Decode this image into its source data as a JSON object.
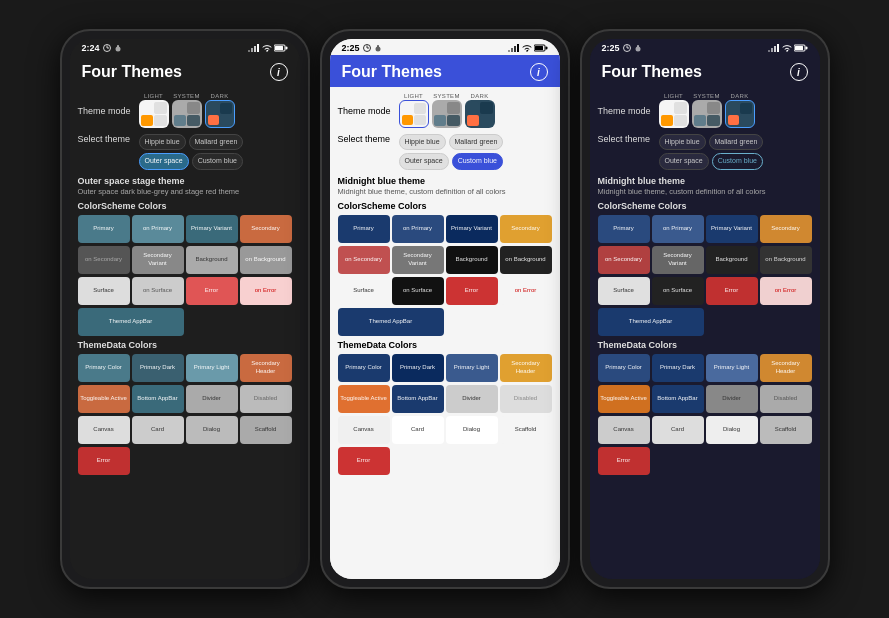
{
  "phones": [
    {
      "id": "phone-dark",
      "variant": "dark",
      "status": {
        "time": "2:24",
        "icons_left": [
          "clock",
          "notification"
        ],
        "icons_right": [
          "signal",
          "wifi",
          "battery"
        ]
      },
      "app_title": "Four Themes",
      "theme_mode": {
        "label": "Theme mode",
        "options": [
          "LIGHT",
          "SYSTEM",
          "DARK"
        ],
        "selected": "DARK"
      },
      "select_theme": {
        "label": "Select theme",
        "options": [
          {
            "name": "Hippie blue",
            "selected": false
          },
          {
            "name": "Mallard green",
            "selected": false
          },
          {
            "name": "Outer space",
            "selected": true
          },
          {
            "name": "Custom blue",
            "selected": false
          }
        ]
      },
      "theme_name": "Outer space stage theme",
      "theme_desc": "Outer space dark blue-grey and stage red theme",
      "colorscheme_title": "ColorScheme Colors",
      "color_rows": [
        [
          {
            "label": "Primary",
            "bg": "#4a7a8a",
            "color": "#fff"
          },
          {
            "label": "on Primary",
            "bg": "#5a8a9a",
            "color": "#fff"
          },
          {
            "label": "Primary Variant",
            "bg": "#3a6a7a",
            "color": "#fff"
          },
          {
            "label": "Secondary",
            "bg": "#c96a40",
            "color": "#fff"
          }
        ],
        [
          {
            "label": "on Secondary",
            "bg": "#555",
            "color": "#aaa"
          },
          {
            "label": "Secondary Variant",
            "bg": "#888",
            "color": "#fff"
          },
          {
            "label": "Background",
            "bg": "#aaa",
            "color": "#333"
          },
          {
            "label": "on Background",
            "bg": "#999",
            "color": "#fff"
          }
        ],
        [
          {
            "label": "Surface",
            "bg": "#ddd",
            "color": "#333"
          },
          {
            "label": "on Surface",
            "bg": "#ccc",
            "color": "#555"
          },
          {
            "label": "Error",
            "bg": "#e05555",
            "color": "#fff"
          },
          {
            "label": "on Error",
            "bg": "#f8d0d0",
            "color": "#c00"
          }
        ],
        [
          {
            "label": "Themed AppBar",
            "bg": "#3a6a7a",
            "color": "#fff",
            "span": 2
          }
        ]
      ],
      "themedata_title": "ThemeData Colors",
      "themedata_rows": [
        [
          {
            "label": "Primary Color",
            "bg": "#4a7a8a",
            "color": "#fff"
          },
          {
            "label": "Primary Dark",
            "bg": "#3a6070",
            "color": "#fff"
          },
          {
            "label": "Primary Light",
            "bg": "#6a9aaa",
            "color": "#fff"
          },
          {
            "label": "Secondary Header",
            "bg": "#c96a40",
            "color": "#fff"
          }
        ],
        [
          {
            "label": "Toggleable Active",
            "bg": "#c96a40",
            "color": "#fff"
          },
          {
            "label": "Bottom AppBar",
            "bg": "#3a6a7a",
            "color": "#fff"
          },
          {
            "label": "Divider",
            "bg": "#aaa",
            "color": "#333"
          },
          {
            "label": "Disabled",
            "bg": "#bbb",
            "color": "#666"
          }
        ],
        [
          {
            "label": "Canvas",
            "bg": "#ddd",
            "color": "#333"
          },
          {
            "label": "Card",
            "bg": "#ccc",
            "color": "#333"
          },
          {
            "label": "Dialog",
            "bg": "#bbb",
            "color": "#333"
          },
          {
            "label": "Scaffold",
            "bg": "#aaa",
            "color": "#333"
          }
        ]
      ]
    },
    {
      "id": "phone-light",
      "variant": "light",
      "status": {
        "time": "2:25",
        "icons_left": [
          "clock",
          "notification"
        ],
        "icons_right": [
          "signal",
          "wifi",
          "battery"
        ]
      },
      "app_title": "Four Themes",
      "theme_mode": {
        "label": "Theme mode",
        "options": [
          "LIGHT",
          "SYSTEM",
          "DARK"
        ],
        "selected": "LIGHT"
      },
      "select_theme": {
        "label": "Select theme",
        "options": [
          {
            "name": "Hippie blue",
            "selected": false
          },
          {
            "name": "Mallard green",
            "selected": false
          },
          {
            "name": "Outer space",
            "selected": false
          },
          {
            "name": "Custom blue",
            "selected": true
          }
        ]
      },
      "theme_name": "Midnight blue theme",
      "theme_desc": "Midnight blue theme, custom definition of all colors",
      "colorscheme_title": "ColorScheme Colors",
      "color_rows": [
        [
          {
            "label": "Primary",
            "bg": "#1a3a6e",
            "color": "#fff"
          },
          {
            "label": "on Primary",
            "bg": "#2a4a7e",
            "color": "#fff"
          },
          {
            "label": "Primary Variant",
            "bg": "#0a2a5e",
            "color": "#fff"
          },
          {
            "label": "Secondary",
            "bg": "#e0a030",
            "color": "#fff"
          }
        ],
        [
          {
            "label": "on Secondary",
            "bg": "#c05050",
            "color": "#fff"
          },
          {
            "label": "Secondary Variant",
            "bg": "#777",
            "color": "#fff"
          },
          {
            "label": "Background",
            "bg": "#111",
            "color": "#eee"
          },
          {
            "label": "on Background",
            "bg": "#222",
            "color": "#eee"
          }
        ],
        [
          {
            "label": "Surface",
            "bg": "#f5f5f5",
            "color": "#333"
          },
          {
            "label": "on Surface",
            "bg": "#111",
            "color": "#eee"
          },
          {
            "label": "Error",
            "bg": "#cc3333",
            "color": "#fff"
          },
          {
            "label": "on Error",
            "bg": "#f5f5f5",
            "color": "#c00"
          }
        ],
        [
          {
            "label": "Themed AppBar",
            "bg": "#1a3a6e",
            "color": "#fff",
            "span": 2
          }
        ]
      ],
      "themedata_title": "ThemeData Colors",
      "themedata_rows": [
        [
          {
            "label": "Primary Color",
            "bg": "#1a3a6e",
            "color": "#fff"
          },
          {
            "label": "Primary Dark",
            "bg": "#0a2a5e",
            "color": "#fff"
          },
          {
            "label": "Primary Light",
            "bg": "#3a5a8e",
            "color": "#fff"
          },
          {
            "label": "Secondary Header",
            "bg": "#e0a030",
            "color": "#fff"
          }
        ],
        [
          {
            "label": "Toggleable Active",
            "bg": "#e07030",
            "color": "#fff"
          },
          {
            "label": "Bottom AppBar",
            "bg": "#1a3a6e",
            "color": "#fff"
          },
          {
            "label": "Divider",
            "bg": "#ccc",
            "color": "#333"
          },
          {
            "label": "Disabled",
            "bg": "#ddd",
            "color": "#888"
          }
        ],
        [
          {
            "label": "Canvas",
            "bg": "#f0f0f0",
            "color": "#333"
          },
          {
            "label": "Card",
            "bg": "#fff",
            "color": "#333"
          },
          {
            "label": "Dialog",
            "bg": "#fff",
            "color": "#333"
          },
          {
            "label": "Scaffold",
            "bg": "#f5f5f5",
            "color": "#333"
          }
        ]
      ]
    },
    {
      "id": "phone-dark2",
      "variant": "dark-mid",
      "status": {
        "time": "2:25",
        "icons_left": [
          "clock",
          "notification"
        ],
        "icons_right": [
          "signal",
          "wifi",
          "battery"
        ]
      },
      "app_title": "Four Themes",
      "theme_mode": {
        "label": "Theme mode",
        "options": [
          "LIGHT",
          "SYSTEM",
          "DARK"
        ],
        "selected": "DARK"
      },
      "select_theme": {
        "label": "Select theme",
        "options": [
          {
            "name": "Hippie blue",
            "selected": false
          },
          {
            "name": "Mallard green",
            "selected": false
          },
          {
            "name": "Outer space",
            "selected": false
          },
          {
            "name": "Custom blue",
            "selected": true
          }
        ]
      },
      "theme_name": "Midnight blue theme",
      "theme_desc": "Midnight blue theme, custom definition of all colors",
      "colorscheme_title": "ColorScheme Colors",
      "color_rows": [
        [
          {
            "label": "Primary",
            "bg": "#2a4a7e",
            "color": "#fff"
          },
          {
            "label": "on Primary",
            "bg": "#3a5a8e",
            "color": "#fff"
          },
          {
            "label": "Primary Variant",
            "bg": "#1a3a6e",
            "color": "#fff"
          },
          {
            "label": "Secondary",
            "bg": "#d08830",
            "color": "#fff"
          }
        ],
        [
          {
            "label": "on Secondary",
            "bg": "#b04040",
            "color": "#fff"
          },
          {
            "label": "Secondary Variant",
            "bg": "#666",
            "color": "#fff"
          },
          {
            "label": "Background",
            "bg": "#222",
            "color": "#eee"
          },
          {
            "label": "on Background",
            "bg": "#333",
            "color": "#ddd"
          }
        ],
        [
          {
            "label": "Surface",
            "bg": "#e0e0e0",
            "color": "#333"
          },
          {
            "label": "on Surface",
            "bg": "#222",
            "color": "#eee"
          },
          {
            "label": "Error",
            "bg": "#c03030",
            "color": "#fff"
          },
          {
            "label": "on Error",
            "bg": "#f0d0d0",
            "color": "#c00"
          }
        ],
        [
          {
            "label": "Themed AppBar",
            "bg": "#1a3a6e",
            "color": "#fff",
            "span": 2
          }
        ]
      ],
      "themedata_title": "ThemeData Colors",
      "themedata_rows": [
        [
          {
            "label": "Primary Color",
            "bg": "#2a4a7e",
            "color": "#fff"
          },
          {
            "label": "Primary Dark",
            "bg": "#1a3a6e",
            "color": "#fff"
          },
          {
            "label": "Primary Light",
            "bg": "#4a6a9e",
            "color": "#fff"
          },
          {
            "label": "Secondary Header",
            "bg": "#d08830",
            "color": "#fff"
          }
        ],
        [
          {
            "label": "Toggleable Active",
            "bg": "#d07020",
            "color": "#fff"
          },
          {
            "label": "Bottom AppBar",
            "bg": "#1a3a6e",
            "color": "#fff"
          },
          {
            "label": "Divider",
            "bg": "#888",
            "color": "#333"
          },
          {
            "label": "Disabled",
            "bg": "#aaa",
            "color": "#555"
          }
        ],
        [
          {
            "label": "Canvas",
            "bg": "#ccc",
            "color": "#333"
          },
          {
            "label": "Card",
            "bg": "#ddd",
            "color": "#333"
          },
          {
            "label": "Dialog",
            "bg": "#eee",
            "color": "#333"
          },
          {
            "label": "Scaffold",
            "bg": "#bbb",
            "color": "#333"
          }
        ]
      ]
    }
  ],
  "theme_icons": {
    "light": {
      "quadrants": [
        "#f5f5f5",
        "#e0e0e0",
        "#ff9800",
        "#e0e0e0"
      ]
    },
    "system": {
      "quadrants": [
        "#aaaaaa",
        "#888888",
        "#607d8b",
        "#455a64"
      ]
    },
    "dark": {
      "quadrants": [
        "#2a4a5e",
        "#1a3a4e",
        "#ff7043",
        "#2a4a5e"
      ]
    }
  }
}
